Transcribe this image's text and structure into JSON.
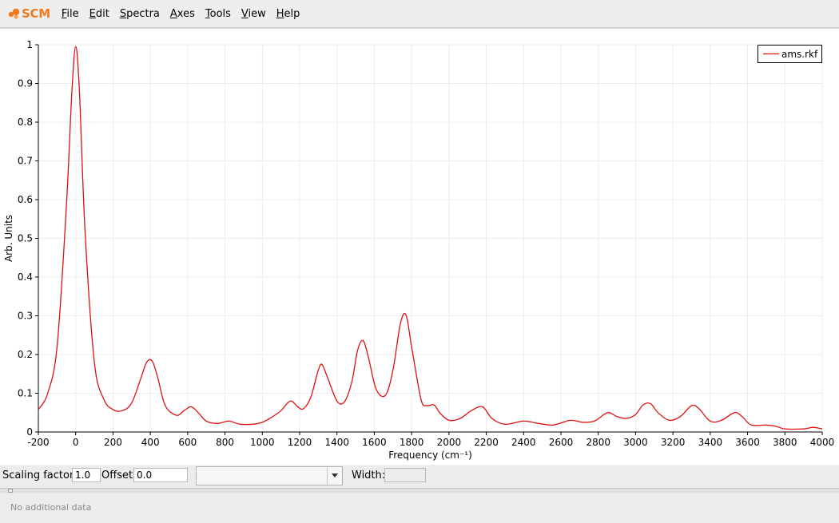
{
  "app": {
    "logo_text": "SCM",
    "accent_color": "#f07a1e"
  },
  "menu": [
    "File",
    "Edit",
    "Spectra",
    "Axes",
    "Tools",
    "View",
    "Help"
  ],
  "controls": {
    "scaling_label": "Scaling factor:",
    "scaling_value": "1.0",
    "offset_label": "Offset:",
    "offset_value": "0.0",
    "spectrum_select_value": "",
    "width_label": "Width:",
    "width_value": ""
  },
  "status": {
    "text": "No additional data"
  },
  "chart_data": {
    "type": "line",
    "xlabel": "Frequency (cm⁻¹)",
    "ylabel": "Arb. Units",
    "xlim": [
      -200,
      4000
    ],
    "ylim": [
      0,
      1
    ],
    "xticks": [
      "-200",
      "0",
      "200",
      "400",
      "600",
      "800",
      "1000",
      "1200",
      "1400",
      "1600",
      "1800",
      "2000",
      "2200",
      "2400",
      "2600",
      "2800",
      "3000",
      "3200",
      "3400",
      "3600",
      "3800",
      "4000"
    ],
    "yticks": [
      "0",
      "0.1",
      "0.2",
      "0.3",
      "0.4",
      "0.5",
      "0.6",
      "0.7",
      "0.8",
      "0.9",
      "1"
    ],
    "grid": true,
    "legend_position": "top-right",
    "series": [
      {
        "name": "ams.rkf",
        "color": "#e01010",
        "x": [
          -200,
          -150,
          -100,
          -50,
          -20,
          0,
          20,
          50,
          100,
          150,
          200,
          250,
          300,
          350,
          380,
          410,
          440,
          480,
          540,
          580,
          620,
          660,
          700,
          760,
          820,
          880,
          950,
          1000,
          1050,
          1100,
          1150,
          1190,
          1220,
          1260,
          1300,
          1320,
          1350,
          1400,
          1440,
          1480,
          1510,
          1540,
          1570,
          1610,
          1660,
          1700,
          1740,
          1770,
          1800,
          1850,
          1880,
          1920,
          1950,
          2000,
          2060,
          2120,
          2180,
          2230,
          2300,
          2400,
          2480,
          2560,
          2650,
          2720,
          2780,
          2830,
          2860,
          2900,
          2950,
          3000,
          3040,
          3080,
          3120,
          3180,
          3240,
          3300,
          3340,
          3400,
          3460,
          3530,
          3570,
          3620,
          3700,
          3750,
          3800,
          3900,
          3950,
          4000
        ],
        "y": [
          0.058,
          0.1,
          0.22,
          0.58,
          0.88,
          0.995,
          0.88,
          0.52,
          0.18,
          0.085,
          0.058,
          0.055,
          0.075,
          0.14,
          0.18,
          0.183,
          0.14,
          0.068,
          0.043,
          0.055,
          0.065,
          0.048,
          0.028,
          0.022,
          0.028,
          0.02,
          0.02,
          0.025,
          0.038,
          0.055,
          0.08,
          0.065,
          0.06,
          0.09,
          0.16,
          0.174,
          0.14,
          0.08,
          0.078,
          0.13,
          0.21,
          0.236,
          0.19,
          0.11,
          0.095,
          0.16,
          0.28,
          0.302,
          0.22,
          0.085,
          0.068,
          0.07,
          0.05,
          0.03,
          0.035,
          0.055,
          0.065,
          0.035,
          0.02,
          0.028,
          0.022,
          0.018,
          0.03,
          0.025,
          0.028,
          0.045,
          0.05,
          0.04,
          0.035,
          0.045,
          0.07,
          0.073,
          0.05,
          0.03,
          0.04,
          0.068,
          0.06,
          0.028,
          0.03,
          0.05,
          0.04,
          0.018,
          0.018,
          0.015,
          0.008,
          0.008,
          0.012,
          0.008
        ]
      }
    ]
  }
}
